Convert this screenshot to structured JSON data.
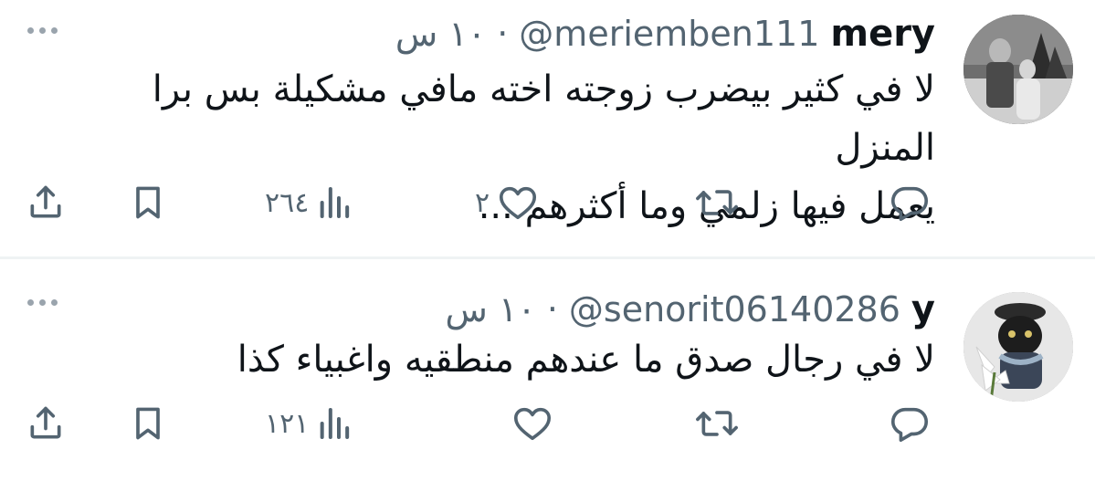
{
  "tweets": [
    {
      "name": "mery",
      "handle": "@meriemben111",
      "separator": "·",
      "time": "١٠ س",
      "lines": [
        "لا في كثير بيضرب زوجته اخته مافي مشكيلة بس برا المنزل",
        "يعمل فيها زلمي وما أكثرهم ..."
      ],
      "views": "٢٦٤",
      "likes": "٢",
      "avatar_icon": "profile-photo-outdoor-couple"
    },
    {
      "name": "y",
      "handle": "@senorit06140286",
      "separator": "·",
      "time": "١٠ س",
      "lines": [
        "لا في رجال صدق ما عندهم منطقيه واغبياء كذا"
      ],
      "views": "١٢١",
      "likes": "",
      "avatar_icon": "profile-photo-cat-with-lilies"
    }
  ],
  "icons": {
    "reply": "reply-icon",
    "retweet": "retweet-icon",
    "like": "heart-icon",
    "views": "views-chart-icon",
    "bookmark": "bookmark-icon",
    "share": "share-icon",
    "more": "more-dots-icon"
  },
  "colors": {
    "text": "#0f1419",
    "secondary": "#536471",
    "icon": "#536471",
    "divider": "#eff3f4"
  }
}
